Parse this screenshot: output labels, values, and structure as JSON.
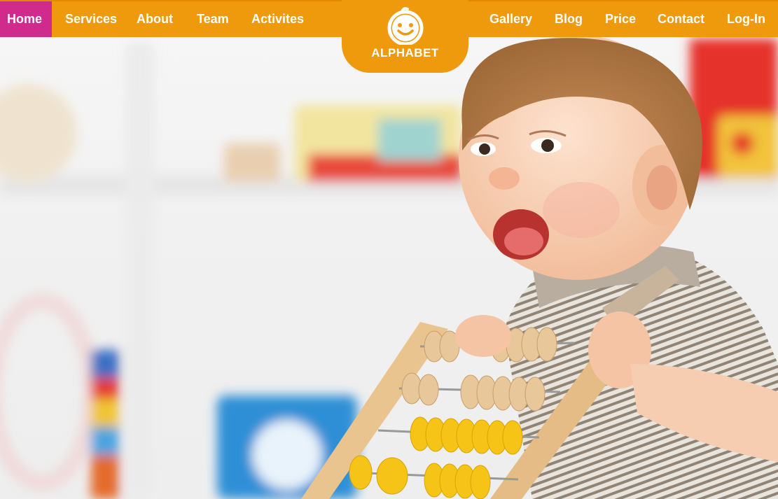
{
  "nav": {
    "left": [
      {
        "label": "Home",
        "active": true
      },
      {
        "label": "Services"
      },
      {
        "label": "About"
      },
      {
        "label": "Team"
      },
      {
        "label": "Activites"
      }
    ],
    "right": [
      {
        "label": "Gallery"
      },
      {
        "label": "Blog"
      },
      {
        "label": "Price"
      },
      {
        "label": "Contact"
      },
      {
        "label": "Log-In"
      }
    ]
  },
  "logo": {
    "text": "ALPHABET",
    "icon": "smiling-child-face-icon"
  },
  "hero": {
    "image": "laughing-baby-with-wooden-abacus-photo"
  },
  "colors": {
    "nav_bg": "#ef9a0d",
    "active_bg": "#d02a8c",
    "nav_text": "#ffffff"
  }
}
